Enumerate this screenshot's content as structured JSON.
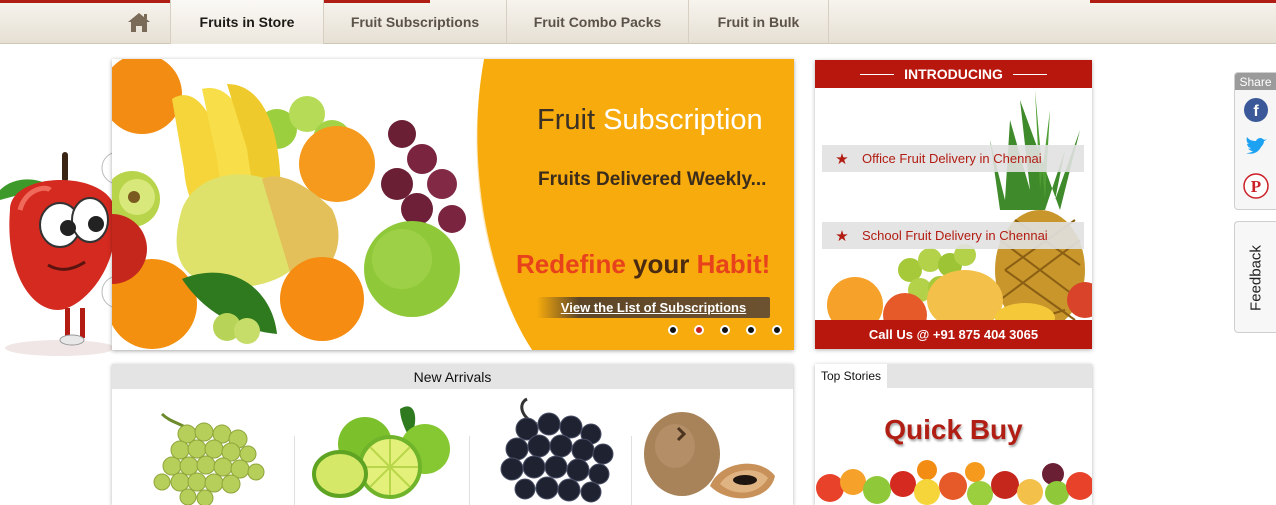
{
  "nav": {
    "home_icon": "home-icon",
    "items": [
      {
        "label": "Fruits in Store",
        "active": true
      },
      {
        "label": "Fruit Subscriptions",
        "active": false
      },
      {
        "label": "Fruit Combo Packs",
        "active": false
      },
      {
        "label": "Fruit in Bulk",
        "active": false
      }
    ]
  },
  "hero": {
    "title_part1": "Fruit",
    "title_part2": "Subscription",
    "subtitle": "Fruits Delivered Weekly...",
    "slogan_1": "Redefine",
    "slogan_2": "your",
    "slogan_3": "Habit!",
    "cta_label": "View the List of Subscriptions",
    "slide_count": 5,
    "active_slide": 2
  },
  "intro": {
    "heading": "INTRODUCING",
    "links": [
      {
        "label": "Office Fruit Delivery in Chennai"
      },
      {
        "label": "School Fruit Delivery in Chennai"
      }
    ],
    "call_text": "Call Us @ +91 875 404 3065"
  },
  "arrivals": {
    "heading": "New Arrivals",
    "products": [
      "green-grapes-image",
      "sweet-lime-image",
      "black-grapes-image",
      "sapota-image"
    ]
  },
  "stories": {
    "tab_label": "Top Stories",
    "banner_text": "Quick Buy"
  },
  "share": {
    "label": "Share",
    "icons": [
      "facebook-icon",
      "twitter-icon",
      "pinterest-icon"
    ]
  },
  "feedback": {
    "label": "Feedback"
  },
  "colors": {
    "brand_red": "#b8170d",
    "hero_orange": "#f7ab0c",
    "slogan_orange": "#e8421d"
  }
}
